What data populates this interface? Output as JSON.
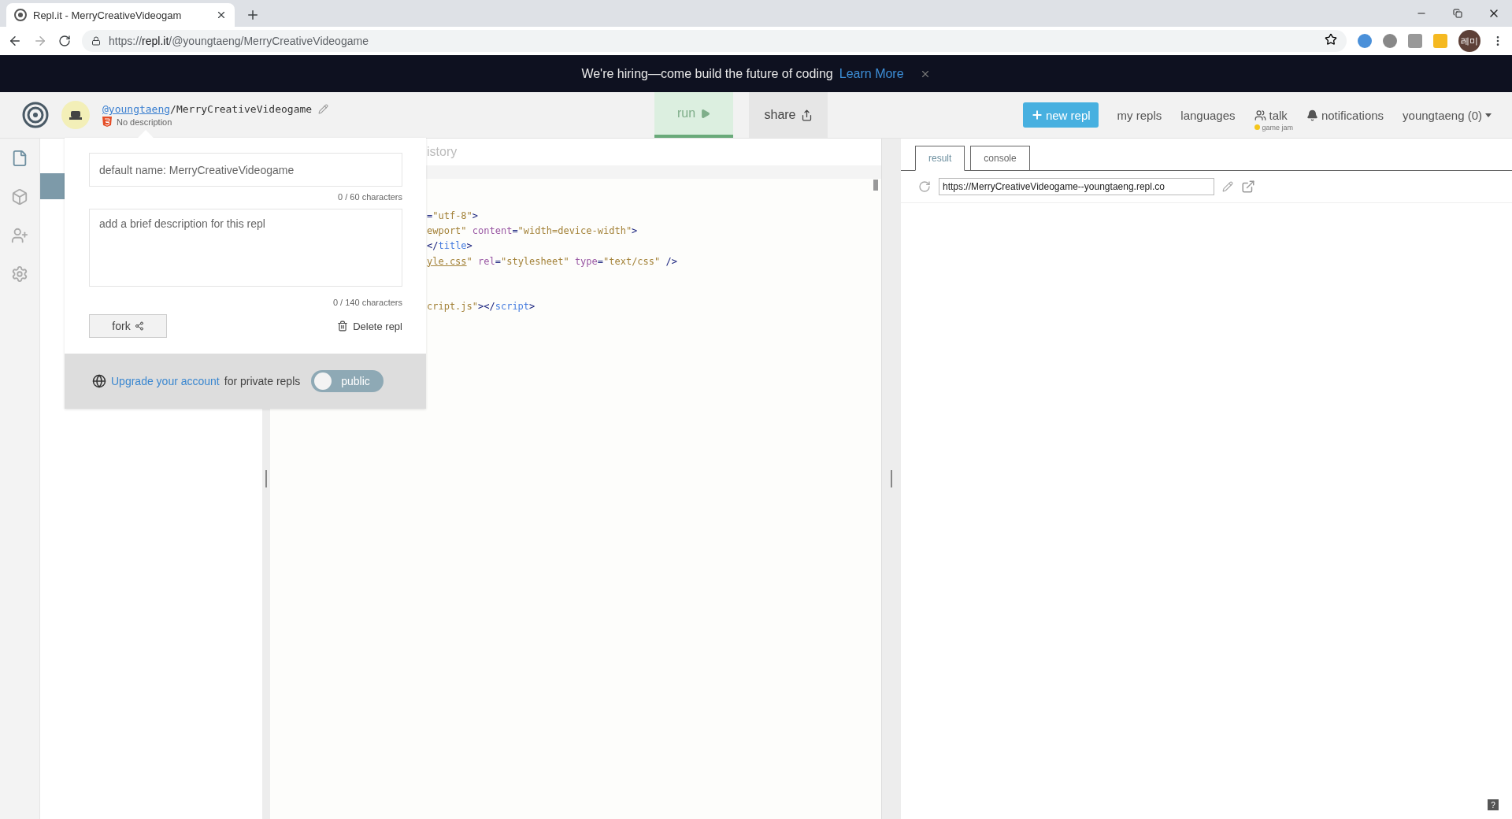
{
  "browser": {
    "tab_title": "Repl.it - MerryCreativeVideogam",
    "url_scheme": "https://",
    "url_host": "repl.it",
    "url_path": "/@youngtaeng/MerryCreativeVideogame",
    "profile_initials": "레미"
  },
  "banner": {
    "text": "We're hiring—come build the future of coding",
    "link": "Learn More"
  },
  "header": {
    "owner": "@youngtaeng",
    "separator": "/",
    "repl_name": "MerryCreativeVideogame",
    "description": "No description",
    "run": {
      "label": "run",
      "selected": true
    },
    "share": "share",
    "new_repl": "new repl",
    "nav": [
      {
        "label": "my repls",
        "kind": "link"
      },
      {
        "label": "languages",
        "kind": "link"
      },
      {
        "label": "talk",
        "kind": "talk",
        "sub": "game jam"
      },
      {
        "label": "notifications",
        "kind": "bell"
      }
    ],
    "user": "youngtaeng (0)"
  },
  "sidebar": [
    {
      "kind": "files",
      "selected": true
    },
    {
      "kind": "packages",
      "selected": false
    },
    {
      "kind": "people",
      "selected": false
    },
    {
      "kind": "settings",
      "selected": false
    }
  ],
  "popup": {
    "name_placeholder": "default name: MerryCreativeVideogame",
    "name_count": "0 / 60 characters",
    "description_placeholder": "add a brief description for this repl",
    "description_count": "0 / 140 characters",
    "fork": "fork",
    "delete": "Delete repl",
    "upgrade_link": "Upgrade your account",
    "upgrade_text": "for private repls",
    "visibility": {
      "label": "public",
      "on": false
    }
  },
  "editor": {
    "tab": "istory",
    "lines": [
      {
        "kind": "code",
        "tokens": [
          {
            "kind": "punct",
            "text": "="
          },
          {
            "kind": "string",
            "text": "\"utf-8\""
          },
          {
            "kind": "punct",
            "text": ">"
          }
        ]
      },
      {
        "kind": "code",
        "tokens": [
          {
            "kind": "string",
            "text": "ewport\""
          },
          {
            "kind": "attr",
            "text": " content"
          },
          {
            "kind": "punct",
            "text": "="
          },
          {
            "kind": "string",
            "text": "\"width=device-width\""
          },
          {
            "kind": "punct",
            "text": ">"
          }
        ]
      },
      {
        "kind": "code",
        "tokens": [
          {
            "kind": "punct",
            "text": "</"
          },
          {
            "kind": "tag",
            "text": "title"
          },
          {
            "kind": "punct",
            "text": ">"
          }
        ]
      },
      {
        "kind": "code",
        "tokens": [
          {
            "kind": "link",
            "text": "yle.css"
          },
          {
            "kind": "string",
            "text": "\""
          },
          {
            "kind": "attr",
            "text": " rel"
          },
          {
            "kind": "punct",
            "text": "="
          },
          {
            "kind": "string",
            "text": "\"stylesheet\""
          },
          {
            "kind": "attr",
            "text": " type"
          },
          {
            "kind": "punct",
            "text": "="
          },
          {
            "kind": "string",
            "text": "\"text/css\""
          },
          {
            "kind": "punct",
            "text": " />"
          }
        ]
      },
      {
        "kind": "blank"
      },
      {
        "kind": "blank"
      },
      {
        "kind": "code",
        "tokens": [
          {
            "kind": "string",
            "text": "cript.js\""
          },
          {
            "kind": "punct",
            "text": "></"
          },
          {
            "kind": "tag",
            "text": "script"
          },
          {
            "kind": "punct",
            "text": ">"
          }
        ]
      }
    ]
  },
  "result": {
    "tabs": [
      {
        "label": "result",
        "selected": true
      },
      {
        "label": "console",
        "selected": false
      }
    ],
    "url": "https://MerryCreativeVideogame--youngtaeng.repl.co"
  },
  "help": "?"
}
